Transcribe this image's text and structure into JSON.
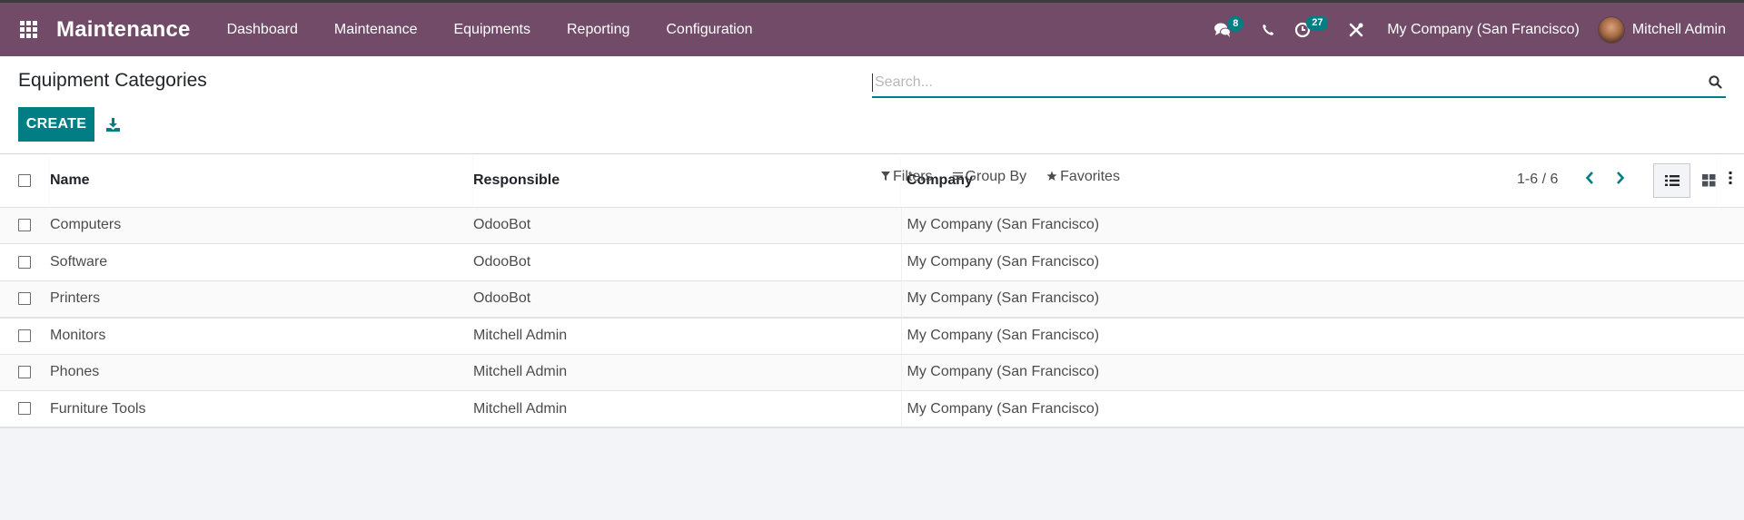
{
  "navbar": {
    "app_title": "Maintenance",
    "menu": [
      "Dashboard",
      "Maintenance",
      "Equipments",
      "Reporting",
      "Configuration"
    ],
    "messages_badge": "8",
    "activities_badge": "27",
    "company": "My Company (San Francisco)",
    "user": "Mitchell Admin",
    "icons": [
      "apps-icon",
      "chat-icon",
      "phone-icon",
      "clock-icon",
      "tools-icon"
    ]
  },
  "control_panel": {
    "title": "Equipment Categories",
    "create_label": "CREATE",
    "search_placeholder": "Search...",
    "search_value": "",
    "filters_label": "Filters",
    "groupby_label": "Group By",
    "favorites_label": "Favorites",
    "pager": "1-6 / 6",
    "active_view": "list"
  },
  "table": {
    "columns": [
      "Name",
      "Responsible",
      "Company"
    ],
    "rows": [
      {
        "name": "Computers",
        "responsible": "OdooBot",
        "company": "My Company (San Francisco)"
      },
      {
        "name": "Software",
        "responsible": "OdooBot",
        "company": "My Company (San Francisco)"
      },
      {
        "name": "Printers",
        "responsible": "OdooBot",
        "company": "My Company (San Francisco)"
      },
      {
        "name": "Monitors",
        "responsible": "Mitchell Admin",
        "company": "My Company (San Francisco)"
      },
      {
        "name": "Phones",
        "responsible": "Mitchell Admin",
        "company": "My Company (San Francisco)"
      },
      {
        "name": "Furniture Tools",
        "responsible": "Mitchell Admin",
        "company": "My Company (San Francisco)"
      }
    ]
  },
  "colors": {
    "navbar": "#714b67",
    "accent": "#017e84"
  }
}
